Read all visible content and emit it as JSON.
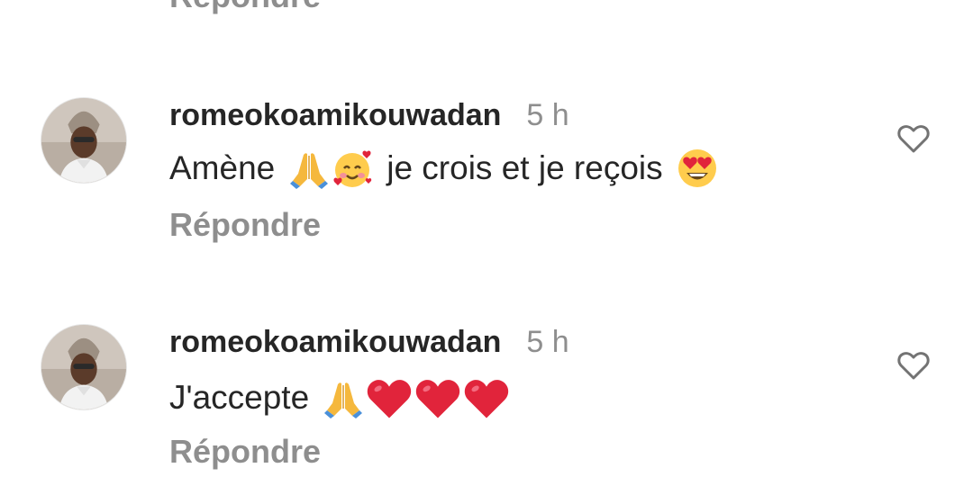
{
  "previous": {
    "reply_label": "Répondre"
  },
  "comments": [
    {
      "username": "romeokoamikouwadan",
      "time": "5 h",
      "text_before": "Amène",
      "emoji_after_1": [
        "folded-hands",
        "smiling-face-with-hearts"
      ],
      "text_middle": "je crois et je reçois",
      "emoji_after_2": [
        "heart-eyes"
      ],
      "reply_label": "Répondre",
      "liked": false
    },
    {
      "username": "romeokoamikouwadan",
      "time": "5 h",
      "text_before": "J'accepte",
      "emoji_after_1": [
        "folded-hands",
        "red-heart",
        "red-heart",
        "red-heart"
      ],
      "reply_label": "Répondre",
      "liked": false
    }
  ],
  "colors": {
    "primary_text": "#262626",
    "secondary_text": "#8e8e8e",
    "background": "#ffffff"
  }
}
